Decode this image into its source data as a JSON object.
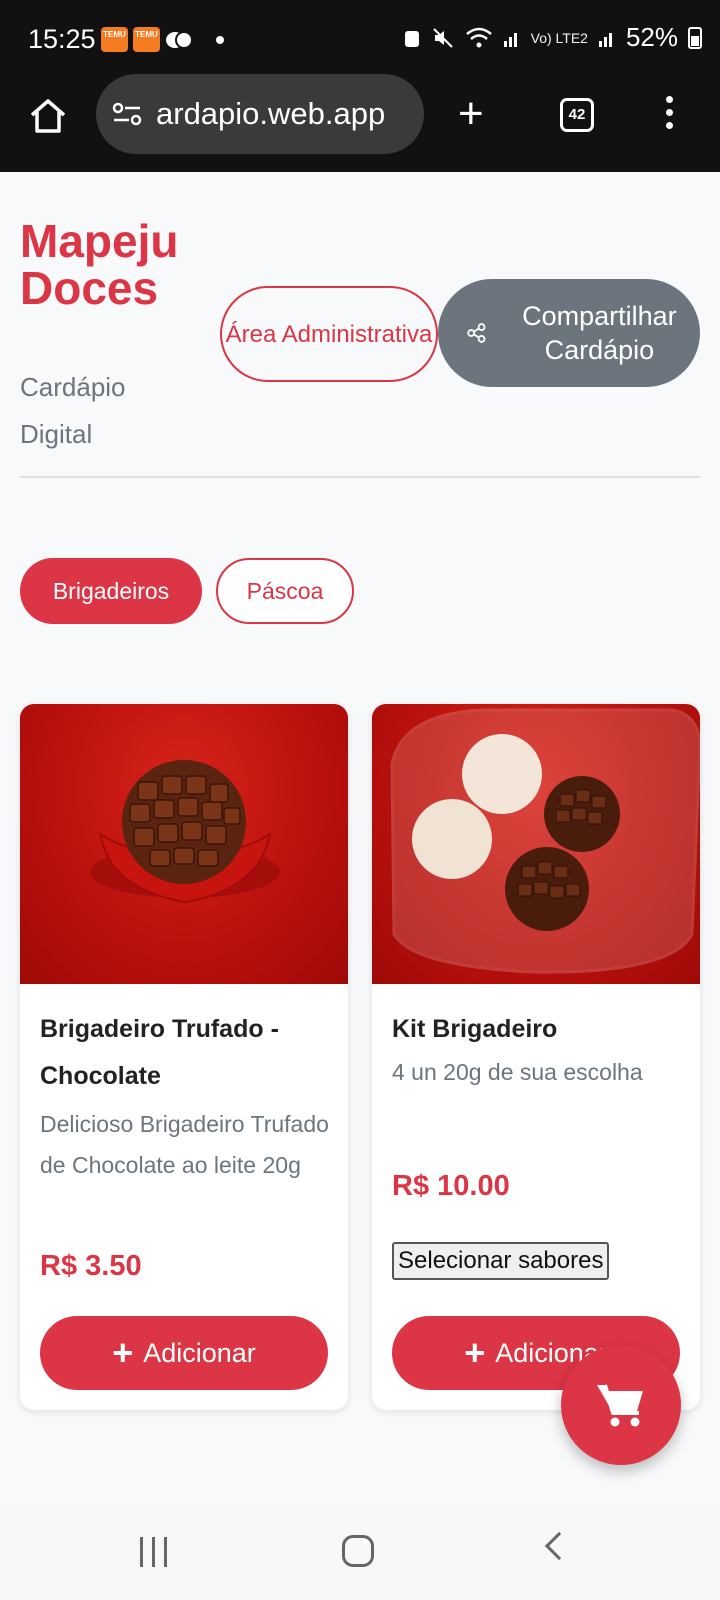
{
  "status_bar": {
    "time": "15:25",
    "app_badges": [
      "TEMU",
      "TEMU"
    ],
    "battery": "52%",
    "network_mini": "Vo) LTE2"
  },
  "browser": {
    "url": "ardapio.web.app",
    "tab_count": "42"
  },
  "header": {
    "title": "Mapeju Doces",
    "subtitle": "Cardápio Digital",
    "admin_button": "Área Administrativa",
    "share_button": "Compartilhar Cardápio"
  },
  "categories": [
    {
      "label": "Brigadeiros",
      "active": true
    },
    {
      "label": "Páscoa",
      "active": false
    }
  ],
  "products": [
    {
      "name": "Brigadeiro Trufado - Chocolate",
      "description": "Delicioso Brigadeiro Trufado de Chocolate ao leite 20g",
      "price": "R$ 3.50",
      "add_button": "Adicionar"
    },
    {
      "name": "Kit Brigadeiro",
      "description": "4 un 20g de sua escolha",
      "price": "R$ 10.00",
      "select_button": "Selecionar sabores",
      "add_button": "Adicionar"
    }
  ],
  "colors": {
    "primary": "#dc3545",
    "secondary": "#6c757d",
    "background": "#f8f9fb"
  }
}
